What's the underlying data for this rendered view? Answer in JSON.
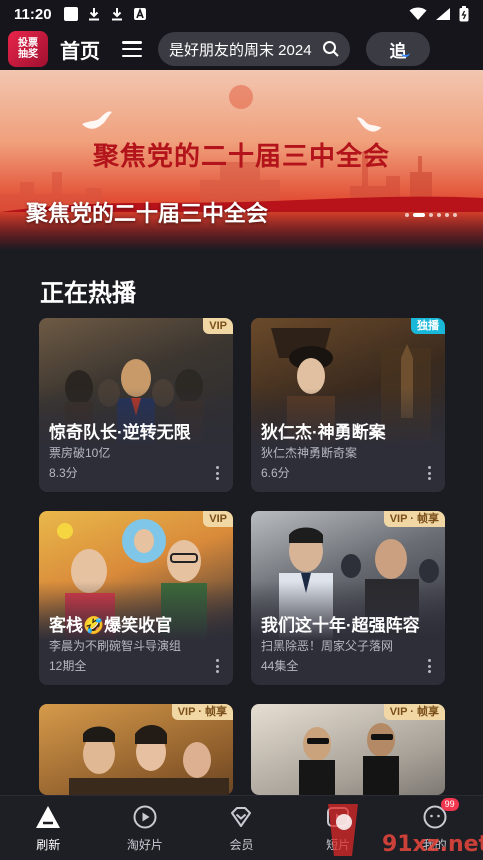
{
  "status_bar": {
    "time": "11:20"
  },
  "header": {
    "logo_line1": "投票",
    "logo_line2": "抽奖",
    "home_title": "首页",
    "search_text": "是好朋友的周末 2024",
    "follow_label": "追"
  },
  "banner": {
    "headline": "聚焦党的二十届三中全会",
    "caption": "聚焦党的二十届三中全会",
    "page_count": 6,
    "active_page": 2
  },
  "section": {
    "title": "正在热播"
  },
  "cards": [
    {
      "title": "惊奇队长·逆转无限",
      "subtitle": "票房破10亿",
      "meta": "8.3分",
      "badge": "VIP",
      "badge_type": "vip"
    },
    {
      "title": "狄仁杰·神勇断案",
      "subtitle": "狄仁杰神勇断奇案",
      "meta": "6.6分",
      "badge": "独播",
      "badge_type": "exclusive"
    },
    {
      "title": "客栈🤣爆笑收官",
      "subtitle": "李晨为不刷碗智斗导演组",
      "meta": "12期全",
      "badge": "VIP",
      "badge_type": "vip"
    },
    {
      "title": "我们这十年·超强阵容",
      "subtitle": "扫黑除恶！周家父子落网",
      "meta": "44集全",
      "badge": "VIP · 帧享",
      "badge_type": "vip"
    },
    {
      "title": "",
      "subtitle": "",
      "meta": "",
      "badge": "VIP · 帧享",
      "badge_type": "vip"
    },
    {
      "title": "",
      "subtitle": "",
      "meta": "",
      "badge": "VIP · 帧享",
      "badge_type": "vip"
    }
  ],
  "bottom_nav": [
    {
      "label": "刷新",
      "icon": "refresh-triangle-icon",
      "active": true
    },
    {
      "label": "淘好片",
      "icon": "play-circle-icon",
      "active": false
    },
    {
      "label": "会员",
      "icon": "diamond-icon",
      "active": false
    },
    {
      "label": "短片",
      "icon": "short-video-icon",
      "active": false
    },
    {
      "label": "我的",
      "icon": "profile-icon",
      "active": false,
      "badge": "99"
    }
  ],
  "watermark": {
    "text": "91xz.net",
    "alt": "下载站"
  },
  "colors": {
    "background": "#1b1b22",
    "vip_badge": "#f1d7a4",
    "exclusive_badge": "#19b7d8",
    "accent_blue": "#3a8bff"
  }
}
